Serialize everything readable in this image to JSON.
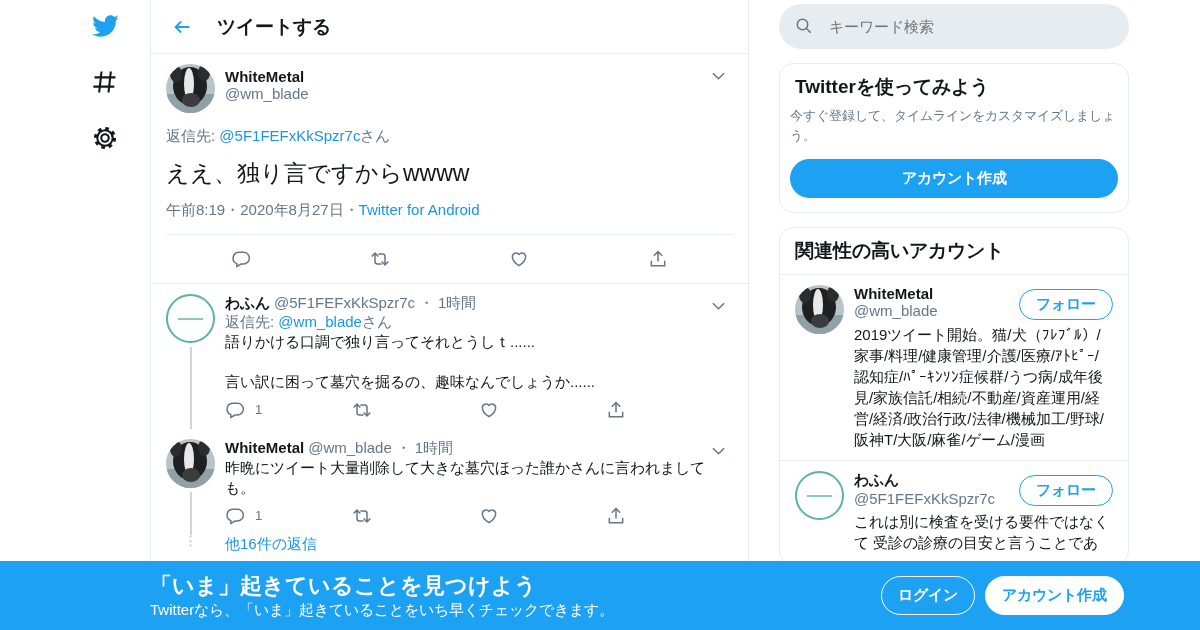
{
  "header": {
    "title": "ツイートする"
  },
  "search": {
    "placeholder": "キーワード検索"
  },
  "main_tweet": {
    "name": "WhiteMetal",
    "handle": "@wm_blade",
    "reply_to": {
      "label": "返信先: ",
      "link": "@5F1FEFxKkSpzr7c",
      "suffix": "さん"
    },
    "text": "ええ、独り言ですからwwww",
    "meta": [
      {
        "kind": "text",
        "text": "午前8:19"
      },
      {
        "kind": "sep",
        "text": "・"
      },
      {
        "kind": "text",
        "text": "2020年8月27日"
      },
      {
        "kind": "sep",
        "text": "・"
      },
      {
        "kind": "link",
        "text": "Twitter for Android"
      }
    ]
  },
  "replies": [
    {
      "kind": "ring",
      "name": "わふん",
      "handle": "@5F1FEFxKkSpzr7c",
      "sep": "・",
      "time": "1時間",
      "reply_to": {
        "label": "返信先: ",
        "link": "@wm_blade",
        "suffix": "さん"
      },
      "text": "語りかける口調で独り言ってそれとうしｔ......\n\n言い訳に困って墓穴を掘るの、趣味なんでしょうか......",
      "reply_count": "1"
    },
    {
      "name": "WhiteMetal",
      "handle": "@wm_blade",
      "sep": "・",
      "time": "1時間",
      "text": "昨晩にツイート大量削除して大きな墓穴ほった誰かさんに言われましても。",
      "reply_count": "1"
    }
  ],
  "more_replies": "他16件の返信",
  "signup_card": {
    "title": "Twitterを使ってみよう",
    "text": "今すぐ登録して、タイムラインをカスタマイズしましょう。",
    "button": "アカウント作成"
  },
  "related": {
    "title": "関連性の高いアカウント",
    "accounts": [
      {
        "name": "WhiteMetal",
        "handle": "@wm_blade",
        "button": "フォロー",
        "bio": "2019ツイート開始。猫/犬（ﾌﾚﾌﾞﾙ）/家事/料理/健康管理/介護/医療/ｱﾄﾋﾟｰ/認知症/ﾊﾟｰｷﾝｿﾝ症候群/うつ病/成年後見/家族信託/相続/不動産/資産運用/経営/経済/政治行政/法律/機械加工/野球/阪神T/大阪/麻雀/ゲーム/漫画"
      },
      {
        "kind": "ring",
        "name": "わふん",
        "handle": "@5F1FEFxKkSpzr7c",
        "button": "フォロー",
        "bio": "これは別に検査を受ける要件ではなくて 受診の診療の目安と言うことであ"
      }
    ]
  },
  "banner": {
    "title": "「いま」起きていることを見つけよう",
    "text": "Twitterなら、「いま」起きていることをいち早くチェックできます。",
    "buttons": [
      {
        "kind": "outline",
        "label": "ログイン"
      },
      {
        "kind": "filled",
        "label": "アカウント作成"
      }
    ]
  }
}
